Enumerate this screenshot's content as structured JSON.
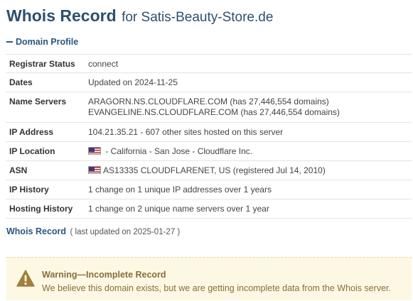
{
  "header": {
    "title": "Whois Record",
    "subtitle": "for Satis-Beauty-Store.de"
  },
  "section": {
    "title": "Domain Profile"
  },
  "profile": {
    "registrar_status": {
      "label": "Registrar Status",
      "value": "connect"
    },
    "dates": {
      "label": "Dates",
      "value": "Updated on 2024-11-25"
    },
    "name_servers": {
      "label": "Name Servers",
      "values": [
        "ARAGORN.NS.CLOUDFLARE.COM (has 27,446,554 domains)",
        "EVANGELINE.NS.CLOUDFLARE.COM (has 27,446,554 domains)"
      ]
    },
    "ip_address": {
      "label": "IP Address",
      "value": "104.21.35.21 - 607 other sites hosted on this server"
    },
    "ip_location": {
      "label": "IP Location",
      "value": " - California - San Jose - Cloudflare Inc.",
      "flag_icon": "us-flag-icon"
    },
    "asn": {
      "label": "ASN",
      "value": "AS13335 CLOUDFLARENET, US (registered Jul 14, 2010)",
      "flag_icon": "us-flag-icon"
    },
    "ip_history": {
      "label": "IP History",
      "value": "1 change on 1 unique IP addresses over 1 years"
    },
    "hosting_history": {
      "label": "Hosting History",
      "value": "1 change on 2 unique name servers over 1 year"
    }
  },
  "whois": {
    "link_label": "Whois Record",
    "note": "( last updated on 2025-01-27 )"
  },
  "warning": {
    "icon": "warning-triangle-icon",
    "title": "Warning—Incomplete Record",
    "text": "We believe this domain exists, but we are getting incomplete data from the Whois server."
  },
  "colors": {
    "heading": "#2c5070",
    "link": "#2a5681",
    "warning_bg": "#fcf8e3",
    "warning_text": "#8a6d3b",
    "warning_icon": "#a17f3c"
  }
}
